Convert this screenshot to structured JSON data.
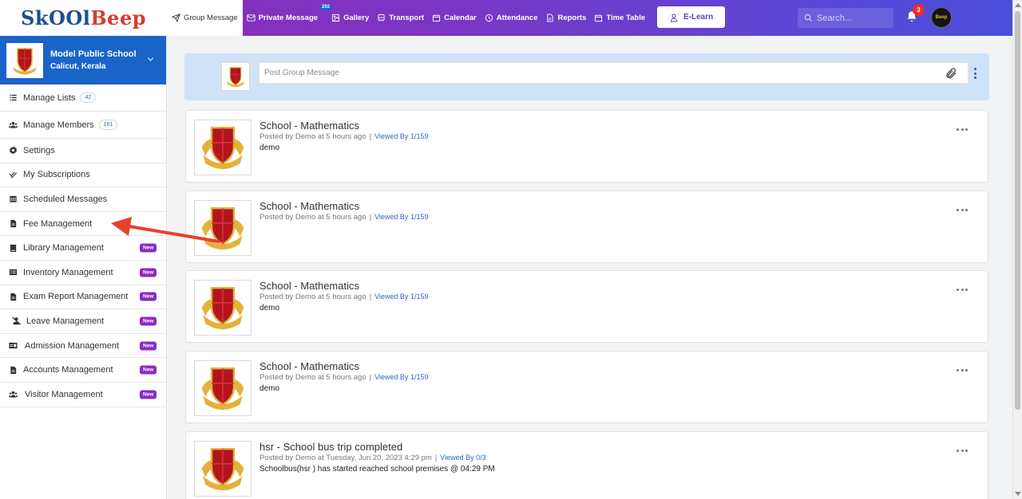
{
  "app": {
    "logo_part1": "SkOOl",
    "logo_part2": "Beep"
  },
  "nav": {
    "items": [
      {
        "label": "Group Message",
        "icon": "send-icon"
      },
      {
        "label": "Private Message",
        "icon": "envelope-icon",
        "badge": "202"
      },
      {
        "label": "Gallery",
        "icon": "image-icon"
      },
      {
        "label": "Transport",
        "icon": "bus-icon"
      },
      {
        "label": "Calendar",
        "icon": "calendar-icon"
      },
      {
        "label": "Attendance",
        "icon": "clock-icon"
      },
      {
        "label": "Reports",
        "icon": "file-icon"
      },
      {
        "label": "Time Table",
        "icon": "calendar-icon"
      }
    ],
    "elearn_label": "E-Learn",
    "search_placeholder": "Search...",
    "notification_count": "3",
    "avatar_text": "Beep"
  },
  "sidebar": {
    "school_name": "Model Public School",
    "school_location": "Calicut, Kerala",
    "items": [
      {
        "label": "Manage Lists",
        "icon": "list-icon",
        "count": "42"
      },
      {
        "label": "Manage Members",
        "icon": "users-icon",
        "count": "161"
      },
      {
        "label": "Settings",
        "icon": "gear-icon"
      },
      {
        "label": "My Subscriptions",
        "icon": "check-double-icon"
      },
      {
        "label": "Scheduled Messages",
        "icon": "calendar-grid-icon"
      },
      {
        "label": "Fee Management",
        "icon": "document-icon"
      },
      {
        "label": "Library Management",
        "icon": "book-icon",
        "new": "New"
      },
      {
        "label": "Inventory Management",
        "icon": "list-box-icon",
        "new": "New"
      },
      {
        "label": "Exam Report Management",
        "icon": "document-icon",
        "new": "New"
      },
      {
        "label": "Leave Management",
        "icon": "user-slash-icon",
        "new": "New"
      },
      {
        "label": "Admission Management",
        "icon": "id-card-icon",
        "new": "New"
      },
      {
        "label": "Accounts Management",
        "icon": "document-icon",
        "new": "New"
      },
      {
        "label": "Visitor Management",
        "icon": "users-icon",
        "new": "New"
      }
    ]
  },
  "composer": {
    "placeholder": "Post Group Message"
  },
  "posts": [
    {
      "title": "School - Mathematics",
      "meta": "Posted by Demo at 5 hours ago",
      "viewed": "Viewed By 1/159",
      "body": "demo"
    },
    {
      "title": "School - Mathematics",
      "meta": "Posted by Demo at 5 hours ago",
      "viewed": "Viewed By 1/159",
      "body": ""
    },
    {
      "title": "School - Mathematics",
      "meta": "Posted by Demo at 5 hours ago",
      "viewed": "Viewed By 1/159",
      "body": "demo"
    },
    {
      "title": "School - Mathematics",
      "meta": "Posted by Demo at 5 hours ago",
      "viewed": "Viewed By 1/159",
      "body": "demo"
    },
    {
      "title": "hsr - School bus trip completed",
      "meta": "Posted by Demo at Tuesday, Jun 20, 2023 4:29 pm",
      "viewed": "Viewed By 0/3",
      "body": "Schoolbus(hsr ) has started reached school premises @ 04:29 PM"
    }
  ],
  "colors": {
    "accent": "#1a64c8",
    "topbar_start": "#8e2bb5",
    "topbar_end": "#4b4fdc",
    "new_badge": "#8a2bc2",
    "annotation_arrow": "#e8402a"
  }
}
